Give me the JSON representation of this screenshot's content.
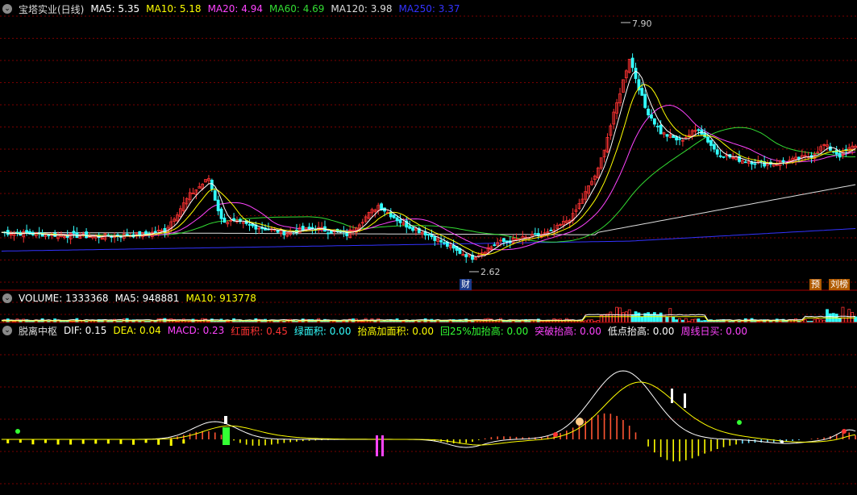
{
  "price_bar": {
    "title": "宝塔实业(日线)",
    "items": [
      {
        "label": "MA5: 5.35",
        "color": "#ffffff"
      },
      {
        "label": "MA10: 5.18",
        "color": "#ffff00"
      },
      {
        "label": "MA20: 4.94",
        "color": "#ff44ff"
      },
      {
        "label": "MA60: 4.69",
        "color": "#33dd33"
      },
      {
        "label": "MA120: 3.98",
        "color": "#dddddd"
      },
      {
        "label": "MA250: 3.37",
        "color": "#3333ff"
      }
    ]
  },
  "volume_bar": {
    "items": [
      {
        "label": "VOLUME: 1333368",
        "color": "#ffffff"
      },
      {
        "label": "MA5: 948881",
        "color": "#ffffff"
      },
      {
        "label": "MA10: 913778",
        "color": "#ffff00"
      }
    ]
  },
  "indicator_bar": {
    "title": "脱离中枢",
    "items": [
      {
        "label": "DIF: 0.15",
        "color": "#ffffff"
      },
      {
        "label": "DEA: 0.04",
        "color": "#ffff00"
      },
      {
        "label": "MACD: 0.23",
        "color": "#ff44ff"
      },
      {
        "label": "红面积: 0.45",
        "color": "#ff3333"
      },
      {
        "label": "绿面积: 0.00",
        "color": "#33ffff"
      },
      {
        "label": "抬高加面积: 0.00",
        "color": "#ffff00"
      },
      {
        "label": "回25%加抬高: 0.00",
        "color": "#33ff33"
      },
      {
        "label": "突破抬高: 0.00",
        "color": "#ff44ff"
      },
      {
        "label": "低点抬高: 0.00",
        "color": "#ffffff"
      },
      {
        "label": "周线日买: 0.00",
        "color": "#ff44ff"
      }
    ]
  },
  "annotations": {
    "high_label": "7.90",
    "low_label": "2.62",
    "cai_tag": "财",
    "yu_tag": "预",
    "liubang_tag": "刘榜"
  },
  "colors": {
    "up": "#ff3333",
    "down": "#33ffff",
    "grid": "#7a0000",
    "ma5": "#ffffff",
    "ma10": "#ffff00",
    "ma20": "#ff44ff",
    "ma60": "#33dd33",
    "ma120": "#dddddd",
    "ma250": "#3333ff"
  },
  "chart_data": {
    "type": "candlestick",
    "ylim": [
      2.2,
      8.5
    ],
    "high": 7.9,
    "low": 2.62,
    "close_keypoints": [
      [
        0,
        3.3
      ],
      [
        30,
        3.2
      ],
      [
        45,
        3.25
      ],
      [
        52,
        3.35
      ],
      [
        60,
        4.2
      ],
      [
        66,
        4.6
      ],
      [
        70,
        3.6
      ],
      [
        80,
        3.45
      ],
      [
        90,
        3.3
      ],
      [
        100,
        3.4
      ],
      [
        110,
        3.25
      ],
      [
        120,
        3.95
      ],
      [
        128,
        3.5
      ],
      [
        136,
        3.25
      ],
      [
        145,
        2.85
      ],
      [
        150,
        2.7
      ],
      [
        158,
        3.05
      ],
      [
        166,
        3.15
      ],
      [
        175,
        3.3
      ],
      [
        182,
        3.7
      ],
      [
        190,
        4.8
      ],
      [
        196,
        6.4
      ],
      [
        200,
        7.5
      ],
      [
        205,
        6.3
      ],
      [
        210,
        5.7
      ],
      [
        216,
        5.5
      ],
      [
        222,
        5.8
      ],
      [
        228,
        5.2
      ],
      [
        235,
        5.05
      ],
      [
        243,
        4.95
      ],
      [
        250,
        5.0
      ],
      [
        258,
        5.15
      ],
      [
        262,
        5.4
      ],
      [
        267,
        5.15
      ],
      [
        272,
        5.4
      ]
    ]
  }
}
